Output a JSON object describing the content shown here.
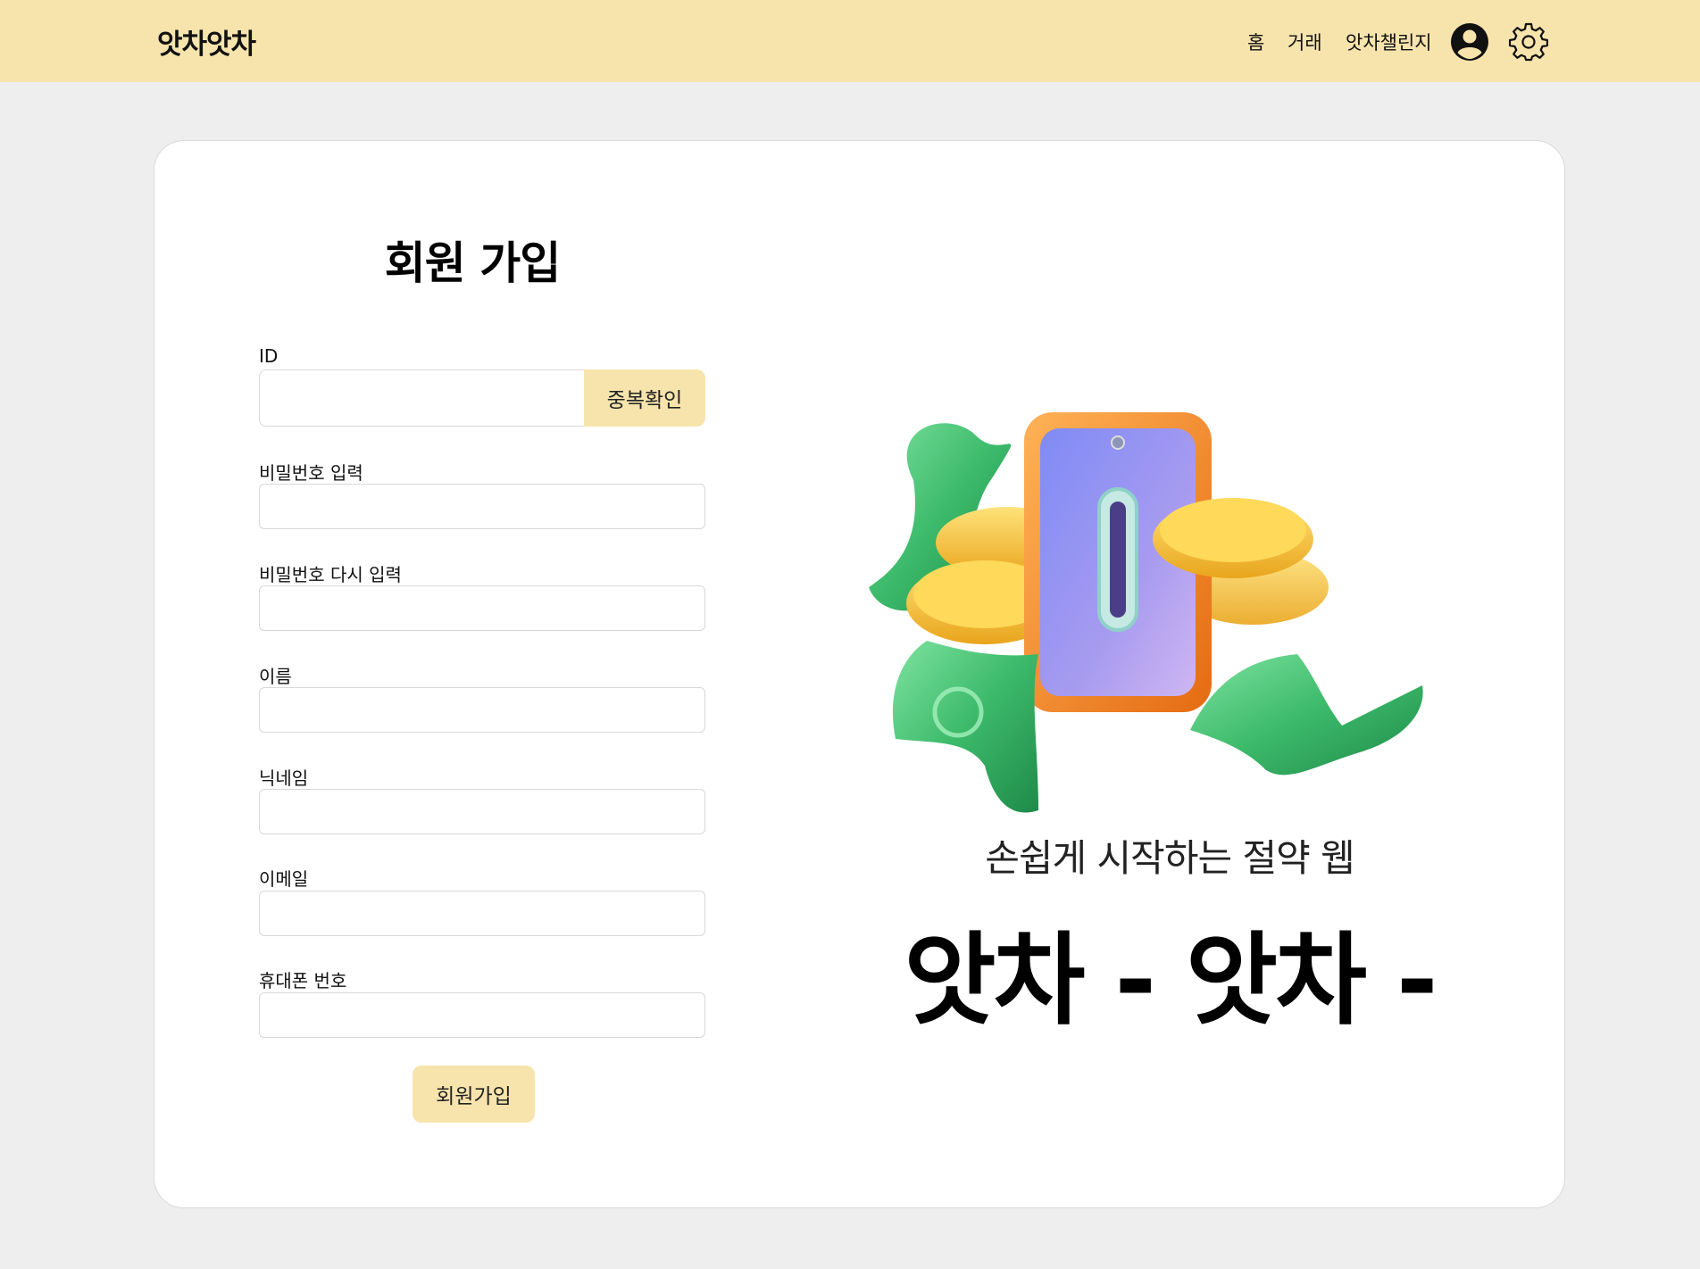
{
  "header": {
    "logo": "앗차앗차",
    "nav": {
      "home": "홈",
      "trade": "거래",
      "challenge": "앗차챌린지"
    },
    "icons": {
      "profile": "profile-icon",
      "settings": "gear-icon"
    },
    "background_color": "#f7e4ad"
  },
  "form": {
    "title": "회원 가입",
    "fields": [
      {
        "label": "ID",
        "value": ""
      },
      {
        "label": "비밀번호 입력",
        "value": ""
      },
      {
        "label": "비밀번호 다시 입력",
        "value": ""
      },
      {
        "label": "이름",
        "value": ""
      },
      {
        "label": "닉네임",
        "value": ""
      },
      {
        "label": "이메일",
        "value": ""
      },
      {
        "label": "휴대폰 번호",
        "value": ""
      }
    ],
    "duplicate_check_label": "중복확인",
    "submit_label": "회원가입",
    "accent_color": "#f7e4ad"
  },
  "promo": {
    "tagline": "손쉽게 시작하는 절약 웹",
    "slogan": "앗차 - 앗차 -",
    "illustration": "phone-money-coins-illustration"
  }
}
